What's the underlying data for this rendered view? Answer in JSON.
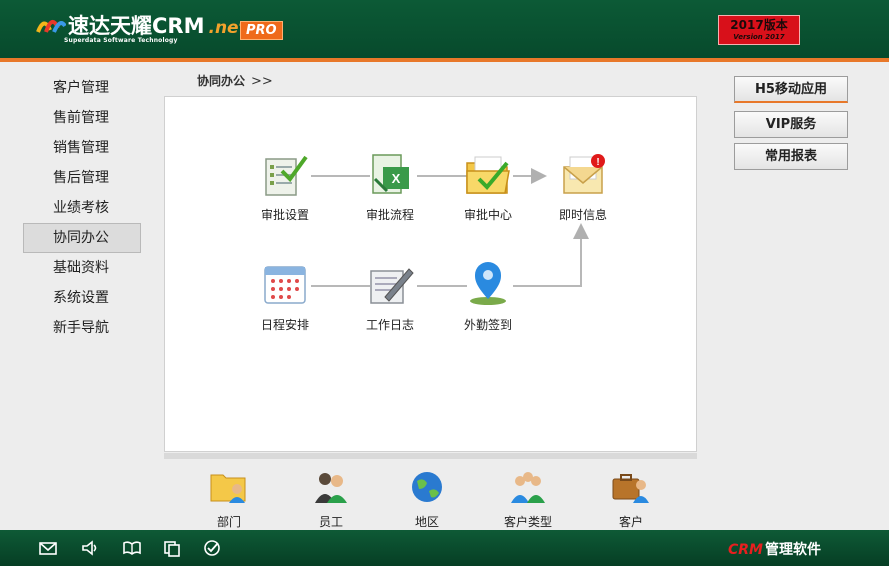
{
  "header": {
    "logo_name": "速达",
    "logo_brand": "天耀CRM",
    "logo_net": ".net",
    "logo_pro": "PRO",
    "logo_subtitle": "Superdata Software Technology",
    "version_line1": "2017版本",
    "version_line2": "Version 2017"
  },
  "nav": {
    "items": [
      {
        "label": "客户管理"
      },
      {
        "label": "售前管理"
      },
      {
        "label": "销售管理"
      },
      {
        "label": "售后管理"
      },
      {
        "label": "业绩考核"
      },
      {
        "label": "协同办公"
      },
      {
        "label": "基础资料"
      },
      {
        "label": "系统设置"
      },
      {
        "label": "新手导航"
      }
    ],
    "active_index": 5
  },
  "breadcrumb": {
    "label": "协同办公",
    "chevron": ">>"
  },
  "flow": {
    "nodes": [
      {
        "label": "审批设置",
        "icon": "approval-settings-icon"
      },
      {
        "label": "审批流程",
        "icon": "approval-flow-icon"
      },
      {
        "label": "审批中心",
        "icon": "approval-center-icon"
      },
      {
        "label": "即时信息",
        "icon": "instant-message-icon"
      },
      {
        "label": "日程安排",
        "icon": "calendar-icon"
      },
      {
        "label": "工作日志",
        "icon": "work-log-icon"
      },
      {
        "label": "外勤签到",
        "icon": "location-pin-icon"
      }
    ]
  },
  "shortcuts": [
    {
      "label": "部门",
      "icon": "department-folder-icon"
    },
    {
      "label": "员工",
      "icon": "employee-icon"
    },
    {
      "label": "地区",
      "icon": "globe-icon"
    },
    {
      "label": "客户类型",
      "icon": "customer-type-icon"
    },
    {
      "label": "客户",
      "icon": "customer-briefcase-icon"
    }
  ],
  "right_buttons": [
    {
      "label": "H5移动应用"
    },
    {
      "label": "VIP服务"
    },
    {
      "label": "常用报表"
    }
  ],
  "footer": {
    "brand_crm": "CRM",
    "brand_text": "管理软件",
    "icons": [
      "mail-icon",
      "speaker-icon",
      "book-icon",
      "copy-icon",
      "check-circle-icon"
    ]
  },
  "colors": {
    "header_green": "#0c5a36",
    "accent_orange": "#e8782a",
    "version_red": "#d8101a",
    "brand_red": "#e81f1f"
  }
}
